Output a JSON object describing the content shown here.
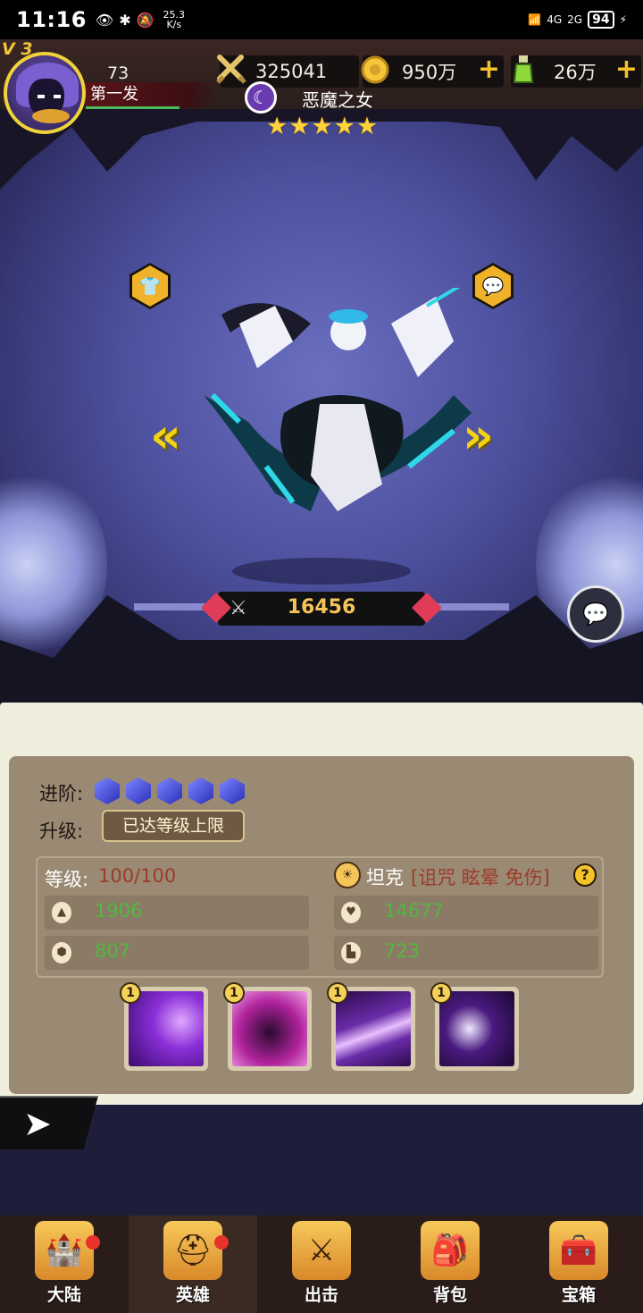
{
  "status_bar": {
    "time": "11:16",
    "speed": "25.3",
    "speed_unit": "K/s",
    "signal1": "4G",
    "signal2": "2G",
    "battery": "94"
  },
  "player": {
    "vip": "V 3",
    "level": "73",
    "name": "第一发"
  },
  "resources": [
    {
      "name": "power",
      "icon": "crossed-swords-icon",
      "value": "325041",
      "has_plus": false
    },
    {
      "name": "gold",
      "icon": "coin-icon",
      "value": "950万",
      "has_plus": true
    },
    {
      "name": "potion",
      "icon": "potion-icon",
      "value": "26万",
      "has_plus": true
    }
  ],
  "plus": "+",
  "hero": {
    "name": "恶魔之女",
    "stars": 5,
    "star_glyph": "★",
    "combat_power": "16456"
  },
  "panel": {
    "advance_label": "进阶:",
    "advance_gems": 5,
    "upgrade_label": "升级:",
    "upgrade_status": "已达等级上限",
    "level_label": "等级:",
    "level_value": "100/100",
    "role_label": "坦克",
    "role_tags": "[诅咒 眩晕 免伤]",
    "help": "?",
    "stats": {
      "attack": "1906",
      "hp": "14677",
      "defense": "807",
      "speed": "723"
    },
    "skills": [
      {
        "level": "1",
        "color": "#8a2fd8"
      },
      {
        "level": "1",
        "color": "#b0239c"
      },
      {
        "level": "1",
        "color": "#6a2ca8"
      },
      {
        "level": "1",
        "color": "#4a1a80"
      }
    ]
  },
  "nav": [
    {
      "label": "大陆",
      "icon": "castle-icon",
      "badge": true,
      "active": false
    },
    {
      "label": "英雄",
      "icon": "helmet-icon",
      "badge": true,
      "active": true
    },
    {
      "label": "出击",
      "icon": "crossed-swords-icon",
      "badge": false,
      "active": false
    },
    {
      "label": "背包",
      "icon": "backpack-icon",
      "badge": false,
      "active": false
    },
    {
      "label": "宝箱",
      "icon": "chest-icon",
      "badge": false,
      "active": false
    }
  ]
}
